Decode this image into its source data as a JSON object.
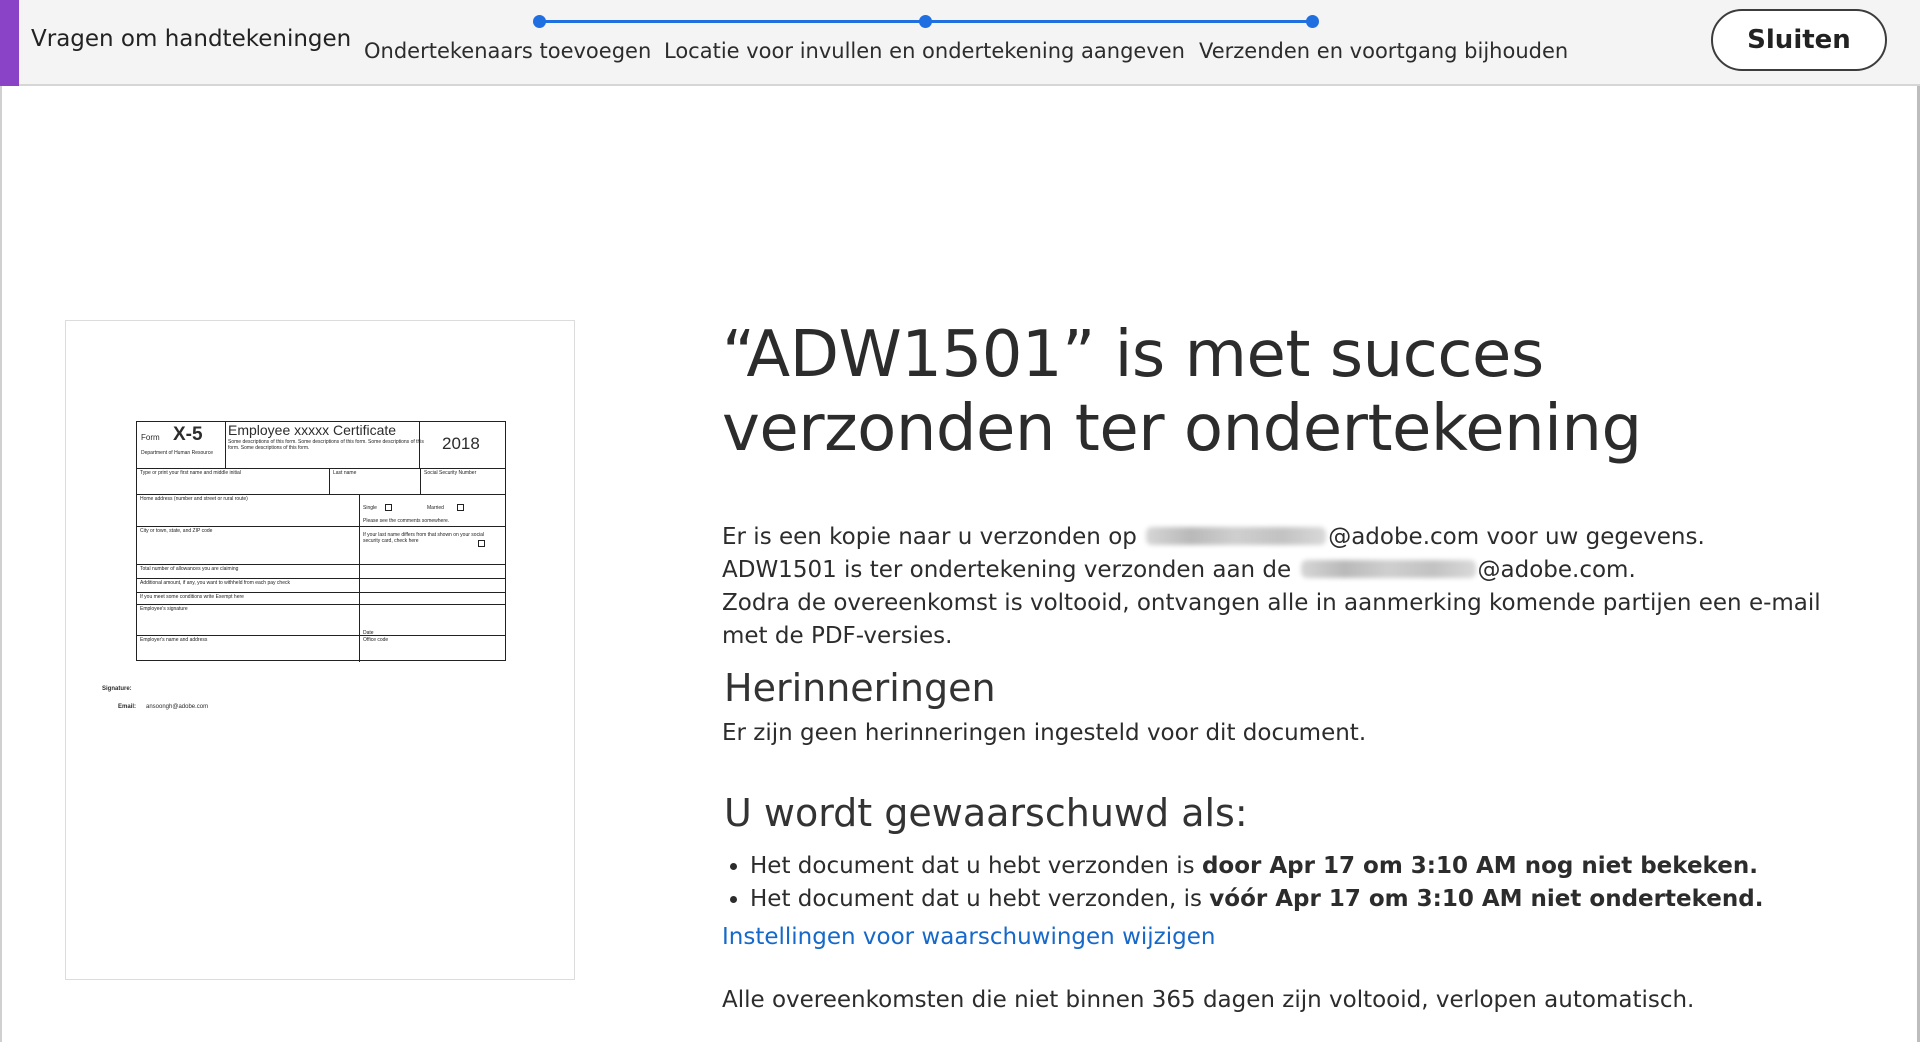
{
  "header": {
    "app_title": "Vragen om handtekeningen",
    "steps": [
      {
        "label": "Ondertekenaars toevoegen"
      },
      {
        "label": "Locatie voor invullen en ondertekening aangeven"
      },
      {
        "label": "Verzenden en voortgang bijhouden"
      }
    ],
    "close_label": "Sluiten",
    "accent_color": "#8a43c6",
    "step_color": "#1f6fe0"
  },
  "document_preview": {
    "form_prefix": "Form",
    "form_id": "X-5",
    "form_title": "Employee xxxxx Certificate",
    "form_year": "2018",
    "dept_label": "Department of Human Resource",
    "description": "Some descriptions of this form. Some descriptions of this form. Some descriptions of this form. Some descriptions of this form.",
    "name_label": "Type or print your first name and middle initial",
    "last_name_label": "Last name",
    "ssn_label": "Social Security Number",
    "address_label": "Home address (number and street or rural route)",
    "single_label": "Single",
    "married_label": "Married",
    "note_label": "Please see the comments somewhere.",
    "city_label": "City or town, state, and ZIP code",
    "diff_label": "If your last name differs from that shown on your social security card, check here",
    "allowances_label": "Total number of allowances you are claiming",
    "additional_label": "Additional amount, if any, you want to withheld from each pay check",
    "exempt_label": "If you meet some conditions write Exempt here",
    "employee_sig_label": "Employee's signature",
    "date_label": "Date",
    "employer_label": "Employer's name and address",
    "office_label": "Office code",
    "signature_label": "Signature:",
    "email_label": "Email:",
    "email_value": "ansoongh@adobe.com"
  },
  "main": {
    "heading": "“ADW1501” is met succes verzonden ter ondertekening",
    "copy_sent_before": "Er is een kopie naar u verzonden op",
    "copy_sent_domain": "@adobe.com voor uw gegevens.",
    "sent_to_before": "ADW1501 is ter ondertekening verzonden aan de",
    "sent_to_domain": "@adobe.com.",
    "completion_text": "Zodra de overeenkomst is voltooid, ontvangen alle in aanmerking komende partijen een e-mail met de PDF-versies.",
    "reminders_heading": "Herinneringen",
    "reminders_text": "Er zijn geen herinneringen ingesteld voor dit document.",
    "notify_heading": "U wordt gewaarschuwd als:",
    "notify_items": [
      {
        "normal": "Het document dat u hebt verzonden is ",
        "bold": "door Apr 17 om 3:10 AM nog niet bekeken."
      },
      {
        "normal": "Het document dat u hebt verzonden, is ",
        "bold": "vóór Apr 17 om 3:10 AM niet ondertekend."
      }
    ],
    "settings_link": "Instellingen voor waarschuwingen wijzigen",
    "expire_text": "Alle overeenkomsten die niet binnen 365 dagen zijn voltooid, verlopen automatisch.",
    "link_color": "#1668c9"
  }
}
